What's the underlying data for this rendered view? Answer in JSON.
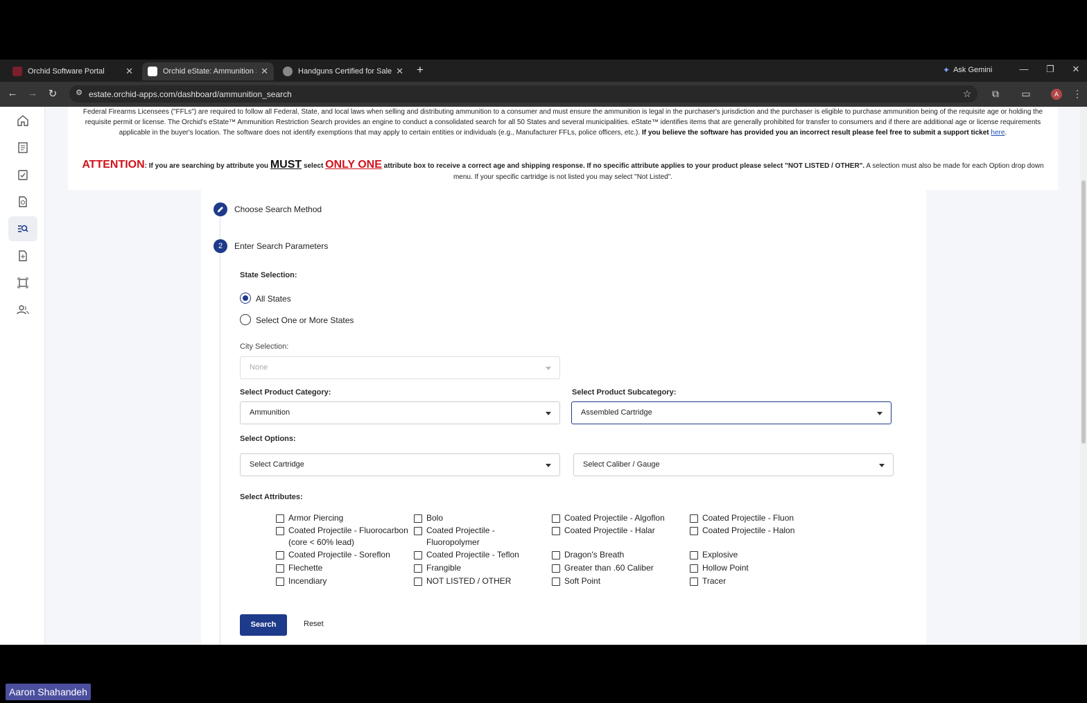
{
  "browser": {
    "tabs": [
      {
        "title": "Orchid Software Portal",
        "active": false
      },
      {
        "title": "Orchid eState: Ammunition Sea",
        "active": true
      },
      {
        "title": "Handguns Certified for Sale | St",
        "active": false
      }
    ],
    "new_tab": "+",
    "gemini_label": "Ask Gemini",
    "url": "estate.orchid-apps.com/dashboard/ammunition_search",
    "profile_initial": "A"
  },
  "notice": {
    "p1_text": "Federal Firearms Licensees (\"FFLs\") are required to follow all Federal, State, and local laws when selling and distributing ammunition to a consumer and must ensure the ammunition is legal in the purchaser's jurisdiction and the purchaser is eligible to purchase ammunition being of the requisite age or holding the requisite permit or license. The Orchid's eState™ Ammunition Restriction Search provides an engine to conduct a consolidated search for all 50 States and several municipalities. eState™ identifies items that are generally prohibited for transfer to consumers and if there are additional age or license requirements applicable in the buyer's location. The software does not identify exemptions that may apply to certain entities or individuals (e.g., Manufacturer FFLs, police officers, etc.).",
    "p1_bold": "If you believe the software has provided you an incorrect result please feel free to submit a support ticket",
    "link": "here",
    "attention": "ATTENTION",
    "a1": ": If you are searching by attribute you",
    "must": "MUST",
    "a2": "select",
    "only_one": "ONLY ONE",
    "a3": "attribute box to receive a correct age and shipping response. If no specific attribute applies to your product please select \"NOT LISTED / OTHER\".",
    "a4": "A selection must also be made for each Option drop down menu. If your specific cartridge is not listed you may select \"Not Listed\"."
  },
  "steps": {
    "step1_label": "Choose Search Method",
    "step2_number": "2",
    "step2_label": "Enter Search Parameters"
  },
  "form": {
    "state_label": "State Selection:",
    "state_options": [
      "All States",
      "Select One or More States"
    ],
    "state_selected": "All States",
    "city_label": "City Selection:",
    "city_value": "None",
    "category_label": "Select Product Category:",
    "category_value": "Ammunition",
    "subcategory_label": "Select Product Subcategory:",
    "subcategory_value": "Assembled Cartridge",
    "options_label": "Select Options:",
    "cartridge_value": "Select Cartridge",
    "caliber_value": "Select Caliber / Gauge",
    "attributes_label": "Select Attributes:",
    "attributes": [
      "Armor Piercing",
      "Bolo",
      "Coated Projectile - Algoflon",
      "Coated Projectile - Fluon",
      "Coated Projectile - Fluorocarbon (core < 60% lead)",
      "Coated Projectile - Fluoropolymer",
      "Coated Projectile - Halar",
      "Coated Projectile - Halon",
      "Coated Projectile - Soreflon",
      "Coated Projectile - Teflon",
      "Dragon's Breath",
      "Explosive",
      "Flechette",
      "Frangible",
      "Greater than .60 Caliber",
      "Hollow Point",
      "Incendiary",
      "NOT LISTED / OTHER",
      "Soft Point",
      "Tracer"
    ],
    "search_label": "Search",
    "reset_label": "Reset"
  },
  "presenter": "Aaron Shahandeh",
  "colors": {
    "primary": "#1e3a8a",
    "attention": "#d0121b",
    "link": "#1a4db8"
  }
}
